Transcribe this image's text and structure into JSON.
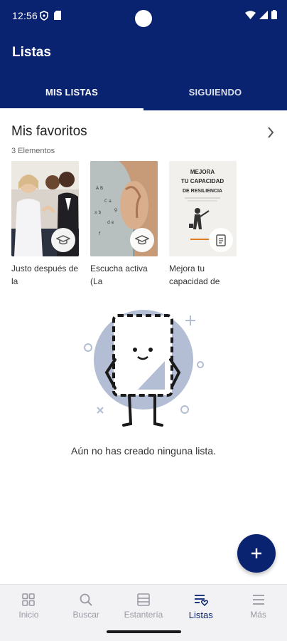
{
  "status_bar": {
    "time": "12:56"
  },
  "header": {
    "title": "Listas",
    "tabs": [
      {
        "label": "MIS LISTAS",
        "active": true
      },
      {
        "label": "SIGUIENDO",
        "active": false
      }
    ]
  },
  "favorites": {
    "title": "Mis favoritos",
    "count_label": "3 Elementos",
    "items": [
      {
        "title": "Justo después de la",
        "type_icon": "graduation-cap-icon"
      },
      {
        "title": "Escucha activa (La",
        "type_icon": "graduation-cap-icon"
      },
      {
        "title": "Mejora tu capacidad de",
        "type_icon": "document-icon",
        "cover_lines": [
          "MEJORA",
          "TU CAPACIDAD",
          "DE RESILIENCIA"
        ]
      }
    ]
  },
  "empty_state": {
    "message": "Aún no has creado ninguna lista."
  },
  "fab": {
    "icon": "plus-icon"
  },
  "bottom_nav": [
    {
      "label": "Inicio",
      "icon": "grid-icon",
      "active": false
    },
    {
      "label": "Buscar",
      "icon": "search-icon",
      "active": false
    },
    {
      "label": "Estantería",
      "icon": "shelf-icon",
      "active": false
    },
    {
      "label": "Listas",
      "icon": "list-heart-icon",
      "active": true
    },
    {
      "label": "Más",
      "icon": "menu-icon",
      "active": false
    }
  ],
  "colors": {
    "brand": "#0a2370",
    "nav_inactive": "#9a9aa4"
  }
}
